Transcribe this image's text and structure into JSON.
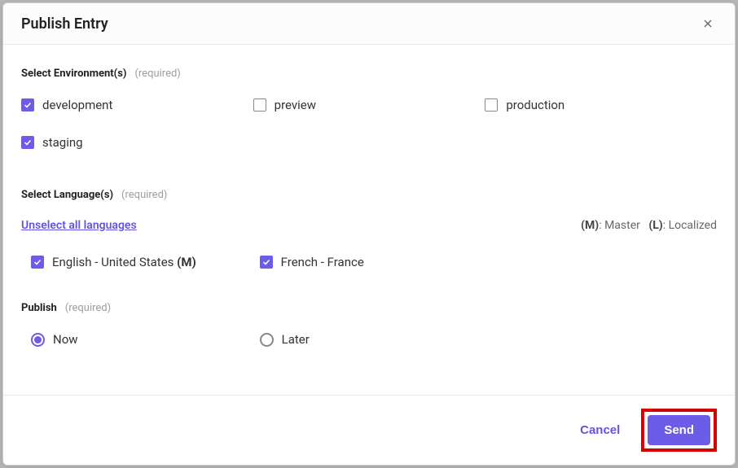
{
  "header": {
    "title": "Publish Entry"
  },
  "environments": {
    "label": "Select Environment(s)",
    "required": "(required)",
    "items": [
      {
        "label": "development",
        "checked": true
      },
      {
        "label": "preview",
        "checked": false
      },
      {
        "label": "production",
        "checked": false
      },
      {
        "label": "staging",
        "checked": true
      }
    ]
  },
  "languages": {
    "label": "Select Language(s)",
    "required": "(required)",
    "unselect_link": "Unselect all languages",
    "legend_master_key": "(M)",
    "legend_master_text": ": Master",
    "legend_local_key": "(L)",
    "legend_local_text": ": Localized",
    "items": [
      {
        "label": "English - United States ",
        "suffix": "(M)",
        "checked": true
      },
      {
        "label": "French - France",
        "suffix": "",
        "checked": true
      }
    ]
  },
  "publish": {
    "label": "Publish",
    "required": "(required)",
    "options": [
      {
        "label": "Now",
        "selected": true
      },
      {
        "label": "Later",
        "selected": false
      }
    ]
  },
  "footer": {
    "cancel": "Cancel",
    "send": "Send"
  }
}
